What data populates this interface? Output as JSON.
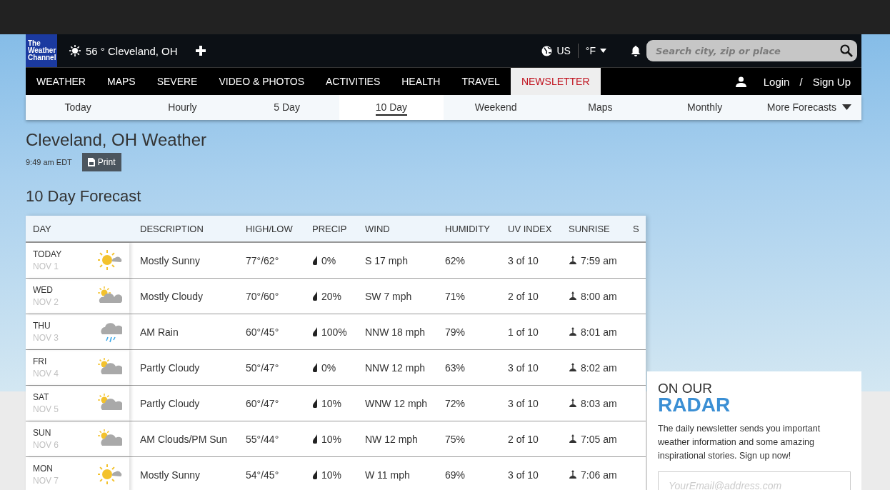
{
  "header": {
    "logo": [
      "The",
      "Weather",
      "Channel"
    ],
    "current": "56 ° Cleveland, OH",
    "region": "US",
    "unit": "°F",
    "search": {
      "placeholder": "Search city, zip or place"
    }
  },
  "nav": {
    "items": [
      {
        "label": "WEATHER",
        "selected": false
      },
      {
        "label": "MAPS",
        "selected": false
      },
      {
        "label": "SEVERE",
        "selected": false
      },
      {
        "label": "VIDEO & PHOTOS",
        "selected": false
      },
      {
        "label": "ACTIVITIES",
        "selected": false
      },
      {
        "label": "HEALTH",
        "selected": false
      },
      {
        "label": "TRAVEL",
        "selected": false
      },
      {
        "label": "NEWSLETTER",
        "selected": true
      }
    ],
    "login": "Login",
    "separator": "/",
    "signup": "Sign Up"
  },
  "subnav": [
    {
      "label": "Today",
      "selected": false
    },
    {
      "label": "Hourly",
      "selected": false
    },
    {
      "label": "5 Day",
      "selected": false
    },
    {
      "label": "10 Day",
      "selected": true
    },
    {
      "label": "Weekend",
      "selected": false
    },
    {
      "label": "Maps",
      "selected": false
    },
    {
      "label": "Monthly",
      "selected": false
    },
    {
      "label": "More Forecasts",
      "selected": false
    }
  ],
  "page": {
    "title": "Cleveland, OH Weather",
    "time": "9:49 am EDT",
    "print": "Print",
    "section": "10 Day Forecast"
  },
  "table": {
    "columns": [
      "DAY",
      "DESCRIPTION",
      "HIGH/LOW",
      "PRECIP",
      "WIND",
      "HUMIDITY",
      "UV INDEX",
      "SUNRISE",
      "S"
    ],
    "rows": [
      {
        "day": "TODAY",
        "date": "NOV 1",
        "kind": "mostly-sunny",
        "description": "Mostly Sunny",
        "high_low": "77°/62°",
        "precip": "0%",
        "wind": "S 17 mph",
        "humidity": "62%",
        "uv": "3 of 10",
        "sunrise": "7:59 am"
      },
      {
        "day": "WED",
        "date": "NOV 2",
        "kind": "mostly-cloudy",
        "description": "Mostly Cloudy",
        "high_low": "70°/60°",
        "precip": "20%",
        "wind": "SW 7 mph",
        "humidity": "71%",
        "uv": "2 of 10",
        "sunrise": "8:00 am"
      },
      {
        "day": "THU",
        "date": "NOV 3",
        "kind": "rain",
        "description": "AM Rain",
        "high_low": "60°/45°",
        "precip": "100%",
        "wind": "NNW 18 mph",
        "humidity": "79%",
        "uv": "1 of 10",
        "sunrise": "8:01 am"
      },
      {
        "day": "FRI",
        "date": "NOV 4",
        "kind": "partly-cloudy",
        "description": "Partly Cloudy",
        "high_low": "50°/47°",
        "precip": "0%",
        "wind": "NNW 12 mph",
        "humidity": "63%",
        "uv": "3 of 10",
        "sunrise": "8:02 am"
      },
      {
        "day": "SAT",
        "date": "NOV 5",
        "kind": "partly-cloudy",
        "description": "Partly Cloudy",
        "high_low": "60°/47°",
        "precip": "10%",
        "wind": "WNW 12 mph",
        "humidity": "72%",
        "uv": "3 of 10",
        "sunrise": "8:03 am"
      },
      {
        "day": "SUN",
        "date": "NOV 6",
        "kind": "partly-cloudy",
        "description": "AM Clouds/PM Sun",
        "high_low": "55°/44°",
        "precip": "10%",
        "wind": "NW 12 mph",
        "humidity": "75%",
        "uv": "2 of 10",
        "sunrise": "7:05 am"
      },
      {
        "day": "MON",
        "date": "NOV 7",
        "kind": "mostly-sunny",
        "description": "Mostly Sunny",
        "high_low": "54°/45°",
        "precip": "10%",
        "wind": "W 11 mph",
        "humidity": "69%",
        "uv": "3 of 10",
        "sunrise": "7:06 am"
      }
    ]
  },
  "sidebar": {
    "kicker": "ON OUR",
    "title": "RADAR",
    "text": "The daily newsletter sends you important weather information and some amazing inspirational stories. Sign up now!",
    "email": {
      "placeholder": "YourEmail@address.com"
    }
  }
}
